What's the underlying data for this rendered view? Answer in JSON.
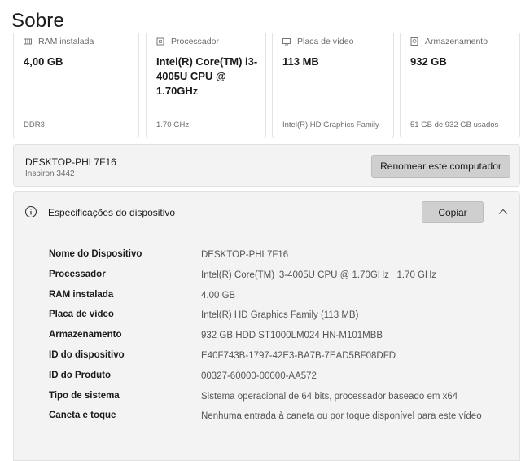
{
  "page": {
    "title": "Sobre"
  },
  "cards": [
    {
      "icon": "ram-icon",
      "label": "RAM instalada",
      "value": "4,00 GB",
      "sub": "DDR3"
    },
    {
      "icon": "processor-icon",
      "label": "Processador",
      "value": "Intel(R) Core(TM) i3-4005U CPU @ 1.70GHz",
      "sub": "1.70 GHz"
    },
    {
      "icon": "video-card-icon",
      "label": "Placa de vídeo",
      "value": "113 MB",
      "sub": "Intel(R) HD Graphics Family"
    },
    {
      "icon": "storage-icon",
      "label": "Armazenamento",
      "value": "932 GB",
      "sub": "51 GB de 932 GB usados"
    }
  ],
  "device": {
    "name": "DESKTOP-PHL7F16",
    "model": "Inspiron 3442",
    "rename_label": "Renomear este computador"
  },
  "specs": {
    "title": "Especificações do dispositivo",
    "copy_label": "Copiar",
    "rows": [
      {
        "label": "Nome do Dispositivo",
        "value": "DESKTOP-PHL7F16"
      },
      {
        "label": "Processador",
        "value": "Intel(R) Core(TM) i3-4005U CPU @ 1.70GHz   1.70 GHz"
      },
      {
        "label": "RAM instalada",
        "value": "4.00 GB"
      },
      {
        "label": "Placa de vídeo",
        "value": "Intel(R) HD Graphics Family (113 MB)"
      },
      {
        "label": "Armazenamento",
        "value": "932 GB HDD ST1000LM024 HN-M101MBB"
      },
      {
        "label": "ID do dispositivo",
        "value": "E40F743B-1797-42E3-BA7B-7EAD5BF08DFD"
      },
      {
        "label": "ID do Produto",
        "value": "00327-60000-00000-AA572"
      },
      {
        "label": "Tipo de sistema",
        "value": "Sistema operacional de 64 bits, processador baseado em x64"
      },
      {
        "label": "Caneta e toque",
        "value": "Nenhuma entrada à caneta ou por toque disponível para este vídeo"
      }
    ]
  },
  "colors": {
    "panel_bg": "#f3f3f3",
    "button_bg": "#cfcfcf",
    "muted_text": "#6b6b6b"
  }
}
